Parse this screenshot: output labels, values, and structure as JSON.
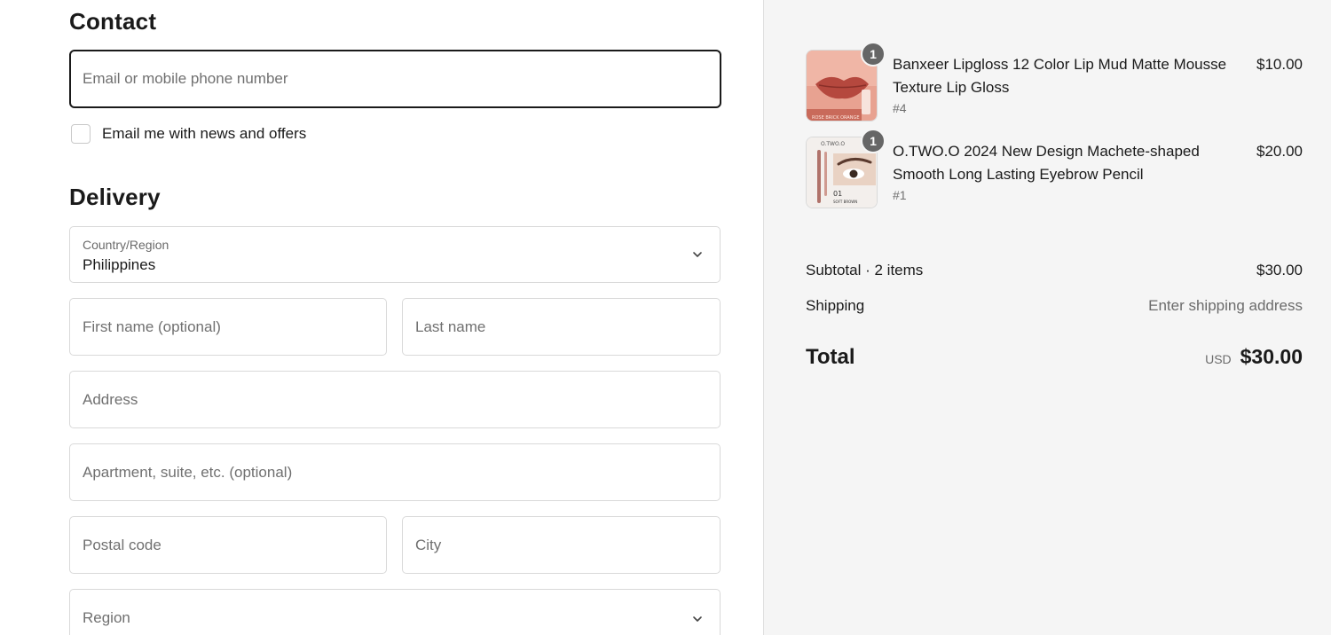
{
  "contact": {
    "title": "Contact",
    "email_placeholder": "Email or mobile phone number",
    "newsletter_label": "Email me with news and offers"
  },
  "delivery": {
    "title": "Delivery",
    "country_label": "Country/Region",
    "country_value": "Philippines",
    "first_name_placeholder": "First name (optional)",
    "last_name_placeholder": "Last name",
    "address_placeholder": "Address",
    "apartment_placeholder": "Apartment, suite, etc. (optional)",
    "postal_placeholder": "Postal code",
    "city_placeholder": "City",
    "region_placeholder": "Region"
  },
  "summary": {
    "items": [
      {
        "name": "Banxeer Lipgloss 12 Color Lip Mud Matte Mousse Texture Lip Gloss",
        "variant": "#4",
        "price": "$10.00",
        "quantity": "1"
      },
      {
        "name": "O.TWO.O 2024 New Design Machete-shaped Smooth Long Lasting Eyebrow Pencil",
        "variant": "#1",
        "price": "$20.00",
        "quantity": "1"
      }
    ],
    "subtotal_label": "Subtotal · 2 items",
    "subtotal_value": "$30.00",
    "shipping_label": "Shipping",
    "shipping_value": "Enter shipping address",
    "total_label": "Total",
    "currency": "USD",
    "total_value": "$30.00"
  },
  "images": {
    "item_1_caption": "ROSE BRICK ORANGE",
    "item_2_brand": "O.TWO.O",
    "item_2_shade_number": "01",
    "item_2_shade_name": "SOFT BROWN"
  },
  "colors": {
    "badge": "#666666",
    "sidebar_bg": "#f5f5f5",
    "focus_border": "#1a1a1a"
  }
}
